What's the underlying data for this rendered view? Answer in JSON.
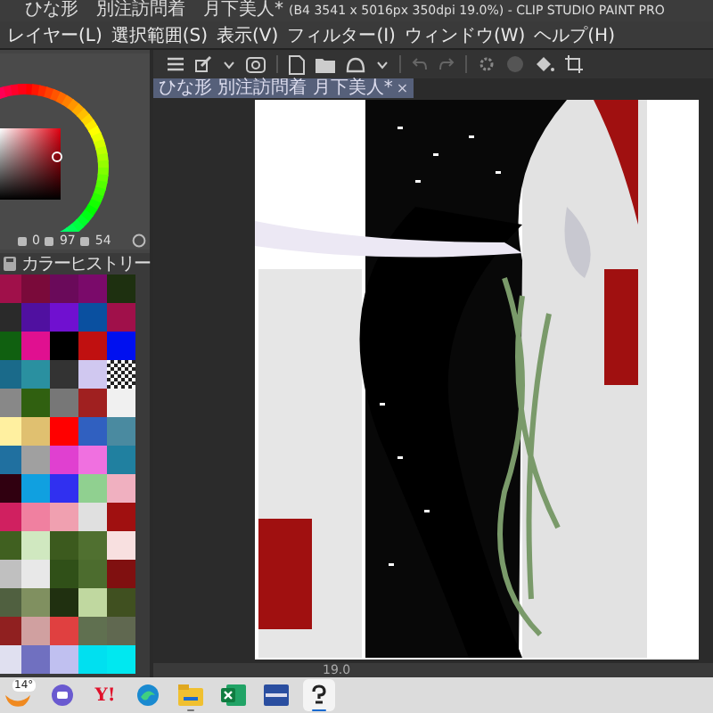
{
  "title_bar": {
    "document": "ひな形　別注訪問着　月下美人*",
    "info": "(B4 3541 x 5016px 350dpi 19.0%) - CLIP STUDIO PAINT PRO"
  },
  "menu": [
    "レイヤー(L)",
    "選択範囲(S)",
    "表示(V)",
    "フィルター(I)",
    "ウィンドウ(W)",
    "ヘルプ(H)"
  ],
  "color_panel": {
    "values": [
      "0",
      "97",
      "54"
    ]
  },
  "color_history": {
    "title": "カラーヒストリー",
    "swatches": [
      {
        "kind": "color",
        "color": "#a0104a"
      },
      {
        "kind": "color",
        "color": "#7a0a3a"
      },
      {
        "kind": "color",
        "color": "#6a0a5a"
      },
      {
        "kind": "color",
        "color": "#7a0a6a"
      },
      {
        "kind": "color",
        "color": "#1e3010"
      },
      {
        "kind": "color",
        "color": "#2a2a2a"
      },
      {
        "kind": "color",
        "color": "#5010a0"
      },
      {
        "kind": "color",
        "color": "#7010d0"
      },
      {
        "kind": "color",
        "color": "#0a50a0"
      },
      {
        "kind": "color",
        "color": "#a0104a"
      },
      {
        "kind": "color",
        "color": "#106010"
      },
      {
        "kind": "color",
        "color": "#e01090"
      },
      {
        "kind": "color",
        "color": "#000000"
      },
      {
        "kind": "color",
        "color": "#c01010"
      },
      {
        "kind": "color",
        "color": "#0010f0"
      },
      {
        "kind": "color",
        "color": "#1a6a8a"
      },
      {
        "kind": "color",
        "color": "#2a90a0"
      },
      {
        "kind": "color",
        "color": "#333333"
      },
      {
        "kind": "color",
        "color": "#d0c8f0"
      },
      {
        "kind": "transparent"
      },
      {
        "kind": "color",
        "color": "#888888"
      },
      {
        "kind": "color",
        "color": "#306010"
      },
      {
        "kind": "color",
        "color": "#777777"
      },
      {
        "kind": "color",
        "color": "#a02020"
      },
      {
        "kind": "color",
        "color": "#f0f0f0"
      },
      {
        "kind": "color",
        "color": "#fff0a0"
      },
      {
        "kind": "color",
        "color": "#e0c070"
      },
      {
        "kind": "color",
        "color": "#ff0000"
      },
      {
        "kind": "color",
        "color": "#3060c0"
      },
      {
        "kind": "color",
        "color": "#4a8aa0"
      },
      {
        "kind": "color",
        "color": "#2070a0"
      },
      {
        "kind": "color",
        "color": "#a0a0a0"
      },
      {
        "kind": "color",
        "color": "#e040d0"
      },
      {
        "kind": "color",
        "color": "#f070e0"
      },
      {
        "kind": "color",
        "color": "#2080a0"
      },
      {
        "kind": "color",
        "color": "#300010"
      },
      {
        "kind": "color",
        "color": "#10a0e0"
      },
      {
        "kind": "color",
        "color": "#3030f0"
      },
      {
        "kind": "color",
        "color": "#90d090"
      },
      {
        "kind": "color",
        "color": "#f0b0c0"
      },
      {
        "kind": "color",
        "color": "#d02060"
      },
      {
        "kind": "color",
        "color": "#f080a0"
      },
      {
        "kind": "color",
        "color": "#f0a0b0"
      },
      {
        "kind": "color",
        "color": "#e0e0e0"
      },
      {
        "kind": "color",
        "color": "#a01010"
      },
      {
        "kind": "color",
        "color": "#406020"
      },
      {
        "kind": "color",
        "color": "#d0e8c0"
      },
      {
        "kind": "color",
        "color": "#3c5a1e"
      },
      {
        "kind": "color",
        "color": "#507030"
      },
      {
        "kind": "color",
        "color": "#f8e0e0"
      },
      {
        "kind": "color",
        "color": "#c0c0c0"
      },
      {
        "kind": "color",
        "color": "#e8e8e8"
      },
      {
        "kind": "color",
        "color": "#305018"
      },
      {
        "kind": "color",
        "color": "#4c6c2e"
      },
      {
        "kind": "color",
        "color": "#801010"
      },
      {
        "kind": "color",
        "color": "#506040"
      },
      {
        "kind": "color",
        "color": "#809060"
      },
      {
        "kind": "color",
        "color": "#203010"
      },
      {
        "kind": "color",
        "color": "#c0d8a0"
      },
      {
        "kind": "color",
        "color": "#405020"
      },
      {
        "kind": "color",
        "color": "#902020"
      },
      {
        "kind": "color",
        "color": "#d0a0a0"
      },
      {
        "kind": "color",
        "color": "#e04040"
      },
      {
        "kind": "color",
        "color": "#607050"
      },
      {
        "kind": "color",
        "color": "#606850"
      },
      {
        "kind": "color",
        "color": "#e0e0f0"
      },
      {
        "kind": "color",
        "color": "#7070c0"
      },
      {
        "kind": "color",
        "color": "#c0c0f0"
      },
      {
        "kind": "color",
        "color": "#00e0f0"
      },
      {
        "kind": "color",
        "color": "#00e8f0"
      }
    ]
  },
  "document_tab": {
    "label": "ひな形 別注訪問着 月下美人*",
    "close": "×"
  },
  "status_bar": {
    "zoom": "19.0"
  },
  "taskbar": {
    "weather": "14°",
    "apps": [
      {
        "kind": "chat",
        "running": false,
        "selected": false
      },
      {
        "kind": "yahoo",
        "label": "Y!",
        "running": false,
        "selected": false
      },
      {
        "kind": "browser",
        "running": false,
        "selected": false
      },
      {
        "kind": "folder",
        "running": true,
        "selected": false
      },
      {
        "kind": "spreadsheet",
        "running": false,
        "selected": false
      },
      {
        "kind": "app",
        "running": false,
        "selected": false
      },
      {
        "kind": "paint",
        "running": true,
        "selected": true
      }
    ]
  }
}
